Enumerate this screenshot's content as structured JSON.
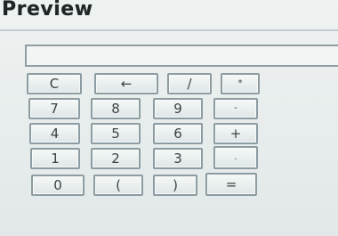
{
  "window": {
    "title": "Preview"
  },
  "display": {
    "value": ""
  },
  "keypad": {
    "clear": "C",
    "backspace": "←",
    "divide": "/",
    "multiply": "*",
    "seven": "7",
    "eight": "8",
    "nine": "9",
    "minus": "-",
    "four": "4",
    "five": "5",
    "six": "6",
    "plus": "+",
    "one": "1",
    "two": "2",
    "three": "3",
    "decimal": ".",
    "zero": "0",
    "open_paren": "(",
    "close_paren": ")",
    "equals": "="
  }
}
